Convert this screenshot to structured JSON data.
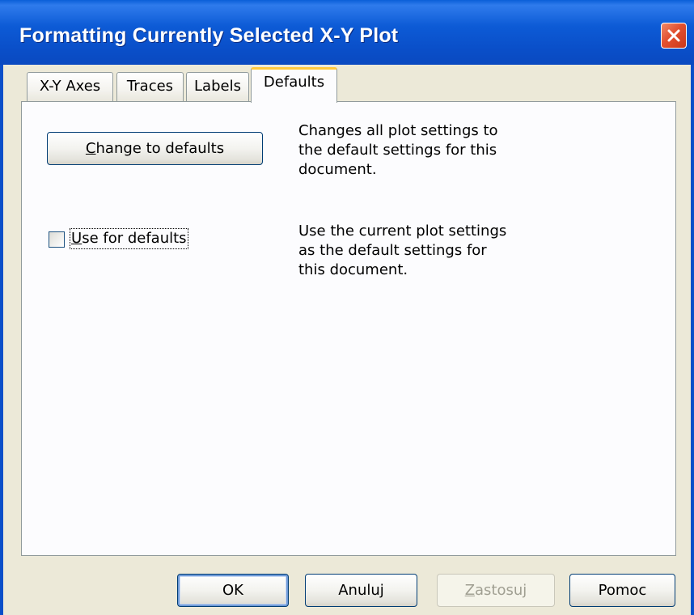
{
  "window": {
    "title": "Formatting Currently Selected X-Y Plot"
  },
  "tabs": [
    {
      "label": "X-Y Axes",
      "active": false
    },
    {
      "label": "Traces",
      "active": false
    },
    {
      "label": "Labels",
      "active": false
    },
    {
      "label": "Defaults",
      "active": true
    }
  ],
  "defaults_tab": {
    "change_button": {
      "label_prefix": "",
      "mnemonic": "C",
      "label_rest": "hange to defaults"
    },
    "change_description": [
      "Changes all plot settings to",
      "the default settings for this",
      "document."
    ],
    "use_checkbox": {
      "checked": false,
      "mnemonic": "U",
      "label_rest": "se for defaults"
    },
    "use_description": [
      "Use the current plot settings",
      "as the default settings for",
      "this document."
    ]
  },
  "footer": {
    "ok": "OK",
    "cancel": "Anuluj",
    "apply": {
      "mnemonic": "Z",
      "label_rest": "astosuj",
      "enabled": false
    },
    "help": "Pomoc"
  },
  "colors": {
    "titlebar": "#0a4fc9",
    "active_tab_accent": "#ffc83c",
    "dialog_bg": "#ece9d8"
  },
  "icons": {
    "close": "close-icon"
  }
}
